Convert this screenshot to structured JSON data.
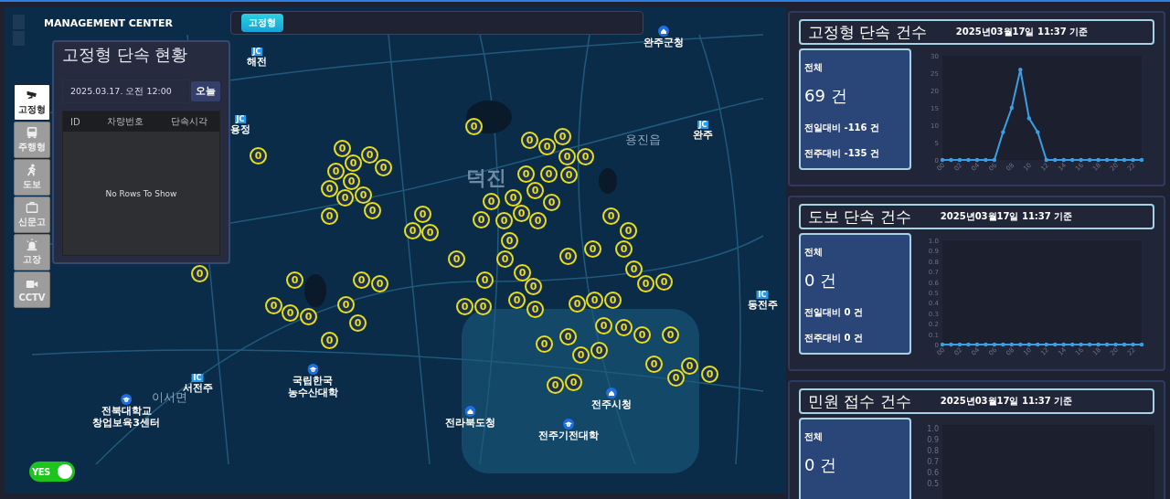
{
  "header": {
    "title": "MANAGEMENT CENTER"
  },
  "filter_bar": {
    "chips": [
      {
        "label": "고정형",
        "selected": true
      }
    ]
  },
  "toolbar": [
    {
      "label": "고정형",
      "selected": true
    },
    {
      "label": "주행형",
      "selected": false
    },
    {
      "label": "도보",
      "selected": false
    },
    {
      "label": "신문고",
      "selected": false
    },
    {
      "label": "고장",
      "selected": false
    },
    {
      "label": "CCTV",
      "selected": false
    }
  ],
  "list_panel": {
    "title": "고정형 단속 현황",
    "date": "2025.03.17. 오전 12:00",
    "today_button": "오늘",
    "columns": [
      "ID",
      "차량번호",
      "단속시각"
    ],
    "empty_text": "No Rows To Show"
  },
  "map": {
    "labels": [
      {
        "kind": "badge",
        "badge": "JC",
        "label": "해전"
      },
      {
        "kind": "office",
        "label": "완주군청"
      },
      {
        "kind": "badge",
        "badge": "JC",
        "label": "용정"
      },
      {
        "kind": "badge",
        "badge": "JC",
        "label": "완주"
      },
      {
        "kind": "area",
        "label": "용진읍"
      },
      {
        "kind": "district",
        "label": "덕진"
      },
      {
        "kind": "badge",
        "badge": "IC",
        "label": "동전주"
      },
      {
        "kind": "badge",
        "badge": "IC",
        "label": "서전주"
      },
      {
        "kind": "school",
        "label": "국립한국\n농수산대학"
      },
      {
        "kind": "school",
        "label": "전북대학교\n창업보육3센터"
      },
      {
        "kind": "area",
        "label": "이서면"
      },
      {
        "kind": "office",
        "label": "전라북도청"
      },
      {
        "kind": "office",
        "label": "전주시청"
      },
      {
        "kind": "school",
        "label": "전주기전대학"
      }
    ],
    "markers": [
      "0",
      "0",
      "0",
      "0",
      "0",
      "0",
      "0",
      "0",
      "0",
      "0",
      "0",
      "0",
      "0",
      "0",
      "0",
      "0",
      "0",
      "0",
      "0",
      "0",
      "0",
      "0",
      "0",
      "0",
      "0",
      "0",
      "0",
      "0",
      "0",
      "0",
      "0",
      "0",
      "0",
      "0",
      "0",
      "0",
      "0",
      "0",
      "0",
      "0",
      "0",
      "0",
      "0",
      "0",
      "0",
      "0",
      "0",
      "0",
      "0",
      "0",
      "0",
      "0",
      "0",
      "0",
      "0",
      "0",
      "0",
      "0",
      "0",
      "0",
      "0",
      "0",
      "0",
      "0",
      "0",
      "0",
      "0",
      "0",
      "0",
      "0",
      "0",
      "0",
      "0",
      "0",
      "0",
      "0",
      "0"
    ],
    "toggle": {
      "label": "YES",
      "on": true
    }
  },
  "cards": [
    {
      "title": "고정형 단속 건수",
      "timestamp": "2025년03월17일 11:37 기준",
      "total_label": "전체",
      "total": "69 건",
      "day_compare": "전일대비 -116 건",
      "week_compare": "전주대비 -135 건",
      "chart_data": {
        "type": "line",
        "x": [
          0,
          1,
          2,
          3,
          4,
          5,
          6,
          7,
          8,
          9,
          10,
          11,
          12,
          13,
          14,
          15,
          16,
          17,
          18,
          19,
          20,
          21,
          22,
          23
        ],
        "xlim": [
          0,
          23
        ],
        "xticks": [
          {
            "value": 0,
            "label": "00"
          },
          {
            "value": 2,
            "label": "02"
          },
          {
            "value": 4,
            "label": "04"
          },
          {
            "value": 6,
            "label": "06"
          },
          {
            "value": 8,
            "label": "08"
          },
          {
            "value": 10,
            "label": "10"
          },
          {
            "value": 12,
            "label": "12"
          },
          {
            "value": 14,
            "label": "14"
          },
          {
            "value": 16,
            "label": "16"
          },
          {
            "value": 18,
            "label": "18"
          },
          {
            "value": 20,
            "label": "20"
          },
          {
            "value": 22,
            "label": "22"
          }
        ],
        "ylim": [
          0,
          30
        ],
        "yticks": [
          0,
          5,
          10,
          15,
          20,
          25,
          30
        ],
        "series": [
          {
            "color": "#3a9ee4",
            "values": [
              0,
              0,
              0,
              0,
              0,
              0,
              0,
              8,
              15,
              26,
              12,
              8,
              0,
              0,
              0,
              0,
              0,
              0,
              0,
              0,
              0,
              0,
              0,
              0
            ]
          }
        ]
      }
    },
    {
      "title": "도보 단속 건수",
      "timestamp": "2025년03월17일 11:37 기준",
      "total_label": "전체",
      "total": "0 건",
      "day_compare": "전일대비 0 건",
      "week_compare": "전주대비 0 건",
      "chart_data": {
        "type": "line",
        "x": [
          0,
          1,
          2,
          3,
          4,
          5,
          6,
          7,
          8,
          9,
          10,
          11,
          12,
          13,
          14,
          15,
          16,
          17,
          18,
          19,
          20,
          21,
          22,
          23
        ],
        "xlim": [
          0,
          23
        ],
        "xticks": [
          {
            "value": 0,
            "label": "00"
          },
          {
            "value": 2,
            "label": "02"
          },
          {
            "value": 4,
            "label": "04"
          },
          {
            "value": 6,
            "label": "06"
          },
          {
            "value": 8,
            "label": "08"
          },
          {
            "value": 10,
            "label": "10"
          },
          {
            "value": 12,
            "label": "12"
          },
          {
            "value": 14,
            "label": "14"
          },
          {
            "value": 16,
            "label": "16"
          },
          {
            "value": 18,
            "label": "18"
          },
          {
            "value": 20,
            "label": "20"
          },
          {
            "value": 22,
            "label": "22"
          }
        ],
        "ylim": [
          0,
          1
        ],
        "yticks": [
          {
            "value": 0,
            "label": "0"
          },
          {
            "value": 0.1,
            "label": "0.1"
          },
          {
            "value": 0.2,
            "label": "0.2"
          },
          {
            "value": 0.3,
            "label": "0.3"
          },
          {
            "value": 0.4,
            "label": "0.4"
          },
          {
            "value": 0.5,
            "label": "0.5"
          },
          {
            "value": 0.6,
            "label": "0.6"
          },
          {
            "value": 0.7,
            "label": "0.7"
          },
          {
            "value": 0.8,
            "label": "0.8"
          },
          {
            "value": 0.9,
            "label": "0.9"
          },
          {
            "value": 1,
            "label": "1.0"
          }
        ],
        "series": [
          {
            "color": "#3a9ee4",
            "values": [
              0,
              0,
              0,
              0,
              0,
              0,
              0,
              0,
              0,
              0,
              0,
              0,
              0,
              0,
              0,
              0,
              0,
              0,
              0,
              0,
              0,
              0,
              0,
              0
            ]
          }
        ]
      }
    },
    {
      "title": "민원 접수 건수",
      "timestamp": "2025년03월17일 11:37 기준",
      "total_label": "전체",
      "total": "0 건",
      "axis_labels": [
        "1.0",
        "0.9",
        "0.8",
        "0.7",
        "0.6",
        "0.5"
      ]
    }
  ]
}
